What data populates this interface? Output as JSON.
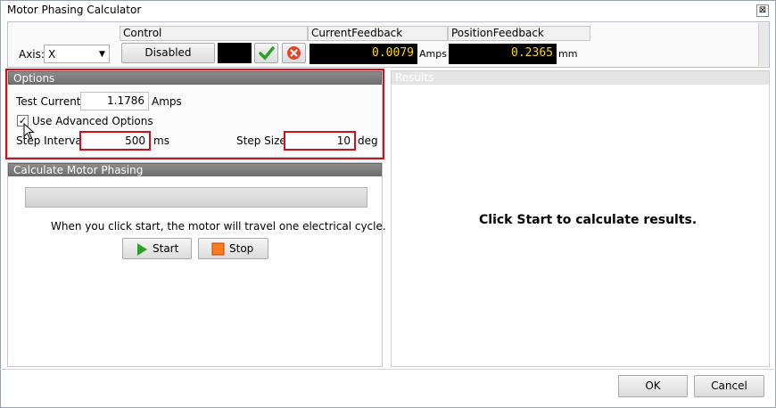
{
  "window": {
    "title": "Motor Phasing Calculator",
    "close_glyph": "⊠"
  },
  "toolbar": {
    "axis_label": "Axis:",
    "axis_value": "X",
    "control_header": "Control",
    "control_state": "Disabled",
    "current_header": "CurrentFeedback",
    "current_value": "0.0079",
    "current_unit": "Amps",
    "position_header": "PositionFeedback",
    "position_value": "0.2365",
    "position_unit": "mm"
  },
  "options": {
    "header": "Options",
    "test_current_label": "Test Current:",
    "test_current_value": "1.1786",
    "test_current_unit": "Amps",
    "advanced_label": "Use Advanced Options",
    "advanced_checked": true,
    "step_interval_label": "Step Interval:",
    "step_interval_value": "500",
    "step_interval_unit": "ms",
    "step_size_label": "Step Size:",
    "step_size_value": "10",
    "step_size_unit": "deg"
  },
  "calc": {
    "header": "Calculate Motor Phasing",
    "progress": 0,
    "info": "When you click start, the motor will travel one electrical cycle.",
    "start_label": "Start",
    "stop_label": "Stop"
  },
  "results": {
    "header": "Results",
    "message": "Click Start to calculate results."
  },
  "footer": {
    "ok_label": "OK",
    "cancel_label": "Cancel"
  },
  "colors": {
    "highlight": "#d0101c",
    "feedback_text": "#ffd700",
    "panel_header": "#7a7a7a"
  }
}
